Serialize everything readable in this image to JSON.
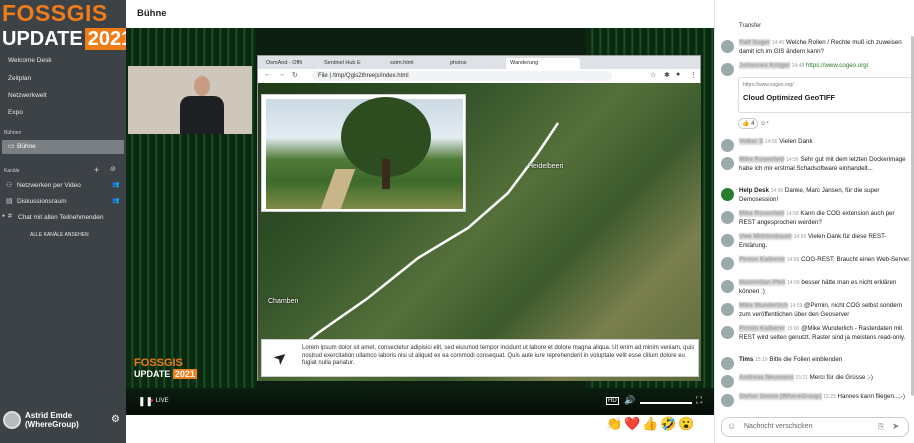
{
  "brand": {
    "line1": "FOSSGIS",
    "line2": "UPDATE",
    "year": "2021"
  },
  "sidebar": {
    "nav": [
      "Welcome Desk",
      "Zeitplan",
      "Netzwerkwelt",
      "Expo"
    ],
    "section_stage": "Bühnen",
    "stage_item": "Bühne",
    "section_channels": "Kanäle",
    "channels": [
      "Netzwerken per Video",
      "Diskussionsraum",
      "Chat mit allen Teilnehmenden"
    ],
    "all_channels": "ALLE KANÄLE ANSEHEN",
    "user": "Astrid Emde (WhereGroup)"
  },
  "main": {
    "title": "Bühne",
    "live": "LIVE",
    "stage_brand": {
      "line1": "FOSSGIS",
      "line2": "UPDATE",
      "year": "2021"
    }
  },
  "browser": {
    "tabs": [
      "OsmAnd - Offli",
      "Sentinel Hub E",
      "sstm.html",
      "photos",
      "Wanderung"
    ],
    "url": "File | /tmp/Qgis2threejs/index.html"
  },
  "map": {
    "label1": "Heidelbeeri",
    "label2": "Chamben"
  },
  "caption": "Lorem ipsum dolor sit amet, consectetur adipisici elit, sed eiusmod tempor incidunt ut labore et dolore magna aliqua. Ut enim ad minim veniam, quis nostrud exercitation ullamco laboris nisi ut aliquid ex ea commodi consequat. Quis aute iure reprehenderit in voluptate velit esse cillum dolore eu fugiat nulla pariatur.",
  "chat": {
    "top_fragment": "Transfer",
    "messages": [
      {
        "name": "Ralf Suger",
        "time": "14:45",
        "text": "Welche Rollen / Rechte muß ich zuweisen damit ich im GIS ändern kann?"
      },
      {
        "name": "Johannes Krüger",
        "time": "14:48",
        "text": "",
        "link": "https://www.cogeo.org/"
      },
      {
        "name": "Volker S",
        "time": "14:56",
        "text": "Vielen Dank"
      },
      {
        "name": "Mike Rosenfeld",
        "time": "14:56",
        "text": "Sehr gut mit dem letzten Dockerimage habe ich mir erstmal Schadsoftware einhandelt..."
      },
      {
        "name": "Help Desk",
        "time": "14:56",
        "text": "Danke, Marc Jansen, für die super Demosession!",
        "clear": true
      },
      {
        "name": "Mike Rosenfeld",
        "time": "14:58",
        "text": "Kann die COG extension auch per REST angesprochen werden?"
      },
      {
        "name": "Uwe Mühlenbauer",
        "time": "14:59",
        "text": "Vielen Dank für diese REST-Erklärung."
      },
      {
        "name": "Pirmin Kalberer",
        "time": "14:59",
        "text": "COG-REST: Braucht einen Web-Server."
      },
      {
        "name": "Maximilian Pfeil",
        "time": "14:59",
        "text": "besser hätte man es nicht erklären können :)"
      },
      {
        "name": "Mike Wunderlich",
        "time": "14:59",
        "text": "@Pirmin, nicht COG selbst sondern zum veröffentlichen über den Geoserver"
      },
      {
        "name": "Pirmin Kalberer",
        "time": "15:00",
        "text": "@Mike Wunderlich - Rasterdaten mit REST wird selten genutzt. Raster sind ja meistens read-only."
      },
      {
        "name": "Tims",
        "time": "15:19",
        "text": "Bitte die Folien einblenden",
        "clear": true
      },
      {
        "name": "Andreas Neumann",
        "time": "15:21",
        "text": "Merci für die Grüsse ;-)"
      },
      {
        "name": "Stefan Steine (WhereGroup)",
        "time": "15:23",
        "text": "Hannes kann fliegen...;-)"
      }
    ],
    "preview": {
      "url": "https://www.cogeo.org/",
      "title": "Cloud Optimized GeoTIFF"
    },
    "reaction_count": "4",
    "input_placeholder": "Nachricht verschicken"
  }
}
